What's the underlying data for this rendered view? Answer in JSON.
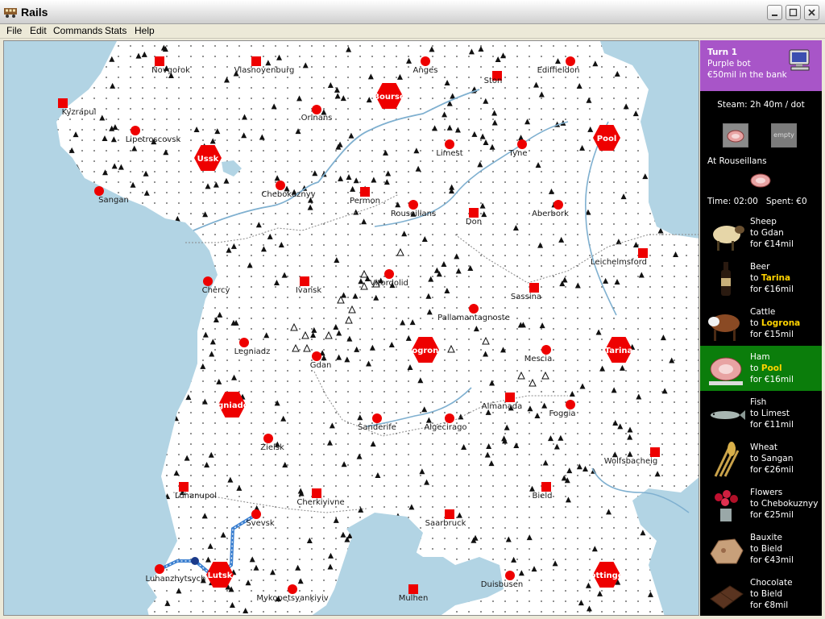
{
  "window": {
    "title": "Rails"
  },
  "menu": [
    "File",
    "Edit",
    "Commands",
    "Stats",
    "Help"
  ],
  "status": {
    "turn": "Turn 1",
    "player": "Purple bot",
    "bank": "€50mil in the bank",
    "steam": "Steam: 2h 40m / dot",
    "train_slots": [
      "ham",
      "empty"
    ],
    "location": "At Rouseillans",
    "time": "Time: 02:00",
    "spent": "Spent: €0"
  },
  "demands": [
    {
      "cargo": "Sheep",
      "to": "Gdan",
      "pay": "for €14mil",
      "icon": "sheep-icon",
      "highlight": false,
      "selected": false
    },
    {
      "cargo": "Beer",
      "to": "Tarina",
      "pay": "for €16mil",
      "icon": "beer-icon",
      "highlight": true,
      "selected": false
    },
    {
      "cargo": "Cattle",
      "to": "Logrona",
      "pay": "for €15mil",
      "icon": "cattle-icon",
      "highlight": true,
      "selected": false
    },
    {
      "cargo": "Ham",
      "to": "Pool",
      "pay": "for €16mil",
      "icon": "ham-icon",
      "highlight": true,
      "selected": true
    },
    {
      "cargo": "Fish",
      "to": "Limest",
      "pay": "for €11mil",
      "icon": "fish-icon",
      "highlight": false,
      "selected": false
    },
    {
      "cargo": "Wheat",
      "to": "Sangan",
      "pay": "for €26mil",
      "icon": "wheat-icon",
      "highlight": false,
      "selected": false
    },
    {
      "cargo": "Flowers",
      "to": "Chebokuznyy",
      "pay": "for €25mil",
      "icon": "flowers-icon",
      "highlight": false,
      "selected": false
    },
    {
      "cargo": "Bauxite",
      "to": "Bield",
      "pay": "for €43mil",
      "icon": "bauxite-icon",
      "highlight": false,
      "selected": false
    },
    {
      "cargo": "Chocolate",
      "to": "Bield",
      "pay": "for €8mil",
      "icon": "chocolate-icon",
      "highlight": false,
      "selected": false
    }
  ],
  "colors": {
    "sea": "#b2d4e4",
    "land": "#ffffff",
    "city": "#ee0000",
    "player": "#a855c8",
    "selected": "#0b7d0b",
    "highlight": "#ffd400",
    "track": "#3a7fd0"
  },
  "map": {
    "cities": [
      {
        "name": "Novgorok",
        "type": "square"
      },
      {
        "name": "Vlasnoyenburg",
        "type": "square"
      },
      {
        "name": "Anges",
        "type": "circle"
      },
      {
        "name": "Ediffieldon",
        "type": "circle"
      },
      {
        "name": "Kyzrapul",
        "type": "square"
      },
      {
        "name": "Bourse",
        "type": "major"
      },
      {
        "name": "Ston",
        "type": "square"
      },
      {
        "name": "Orlnans",
        "type": "circle"
      },
      {
        "name": "Lipetroscovsk",
        "type": "circle"
      },
      {
        "name": "Ussk",
        "type": "major"
      },
      {
        "name": "Limest",
        "type": "circle"
      },
      {
        "name": "Tyne",
        "type": "circle"
      },
      {
        "name": "Pool",
        "type": "major"
      },
      {
        "name": "Sangan",
        "type": "circle"
      },
      {
        "name": "Chebokuznyy",
        "type": "circle"
      },
      {
        "name": "Permon",
        "type": "square"
      },
      {
        "name": "Rouseillans",
        "type": "circle"
      },
      {
        "name": "Don",
        "type": "square"
      },
      {
        "name": "Aberbork",
        "type": "circle"
      },
      {
        "name": "Leichelmsford",
        "type": "square"
      },
      {
        "name": "Chercy",
        "type": "circle"
      },
      {
        "name": "Ivansk",
        "type": "square"
      },
      {
        "name": "Vitordolid",
        "type": "circle"
      },
      {
        "name": "Sassina",
        "type": "square"
      },
      {
        "name": "Pallamantagnoste",
        "type": "circle"
      },
      {
        "name": "Legniadz",
        "type": "circle"
      },
      {
        "name": "Gdan",
        "type": "circle"
      },
      {
        "name": "Logrona",
        "type": "major"
      },
      {
        "name": "Mescia",
        "type": "circle"
      },
      {
        "name": "Tarina",
        "type": "major"
      },
      {
        "name": "Legniadom",
        "type": "major"
      },
      {
        "name": "Almanada",
        "type": "square"
      },
      {
        "name": "Foggia",
        "type": "circle"
      },
      {
        "name": "Sanderife",
        "type": "circle"
      },
      {
        "name": "Algecirago",
        "type": "circle"
      },
      {
        "name": "Zielsk",
        "type": "circle"
      },
      {
        "name": "Wolfsbacheig",
        "type": "square"
      },
      {
        "name": "Luhanupol",
        "type": "square"
      },
      {
        "name": "Cherkiyivne",
        "type": "square"
      },
      {
        "name": "Bield",
        "type": "square"
      },
      {
        "name": "Svevsk",
        "type": "circle"
      },
      {
        "name": "Saarbruck",
        "type": "square"
      },
      {
        "name": "Luhanzhytsych",
        "type": "circle"
      },
      {
        "name": "Lutsk",
        "type": "major"
      },
      {
        "name": "Pottingen",
        "type": "major"
      },
      {
        "name": "Mykopetsyankiyiv",
        "type": "circle"
      },
      {
        "name": "Mulhen",
        "type": "square"
      },
      {
        "name": "Duisbusen",
        "type": "circle"
      }
    ]
  }
}
